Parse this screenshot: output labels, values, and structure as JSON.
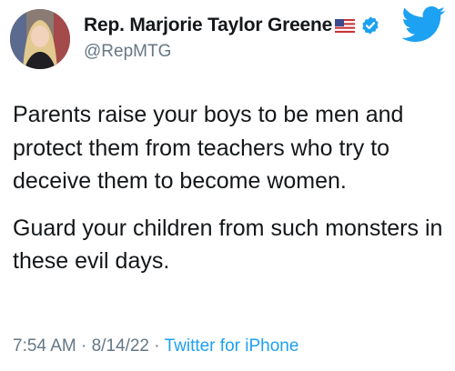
{
  "author": {
    "display_name": "Rep. Marjorie Taylor Greene",
    "handle": "@RepMTG",
    "flag_icon": "us-flag-icon",
    "verified_icon": "verified-badge-icon"
  },
  "app_icon": "twitter-bird-icon",
  "tweet": {
    "paragraphs": [
      "Parents raise your boys to be men and protect them from teachers who try to deceive them to become women.",
      "Guard your children from such monsters in these evil days."
    ]
  },
  "meta": {
    "time": "7:54 AM",
    "separator": " · ",
    "date": "8/14/22",
    "source": "Twitter for iPhone"
  },
  "colors": {
    "text": "#14171a",
    "secondary": "#657786",
    "accent": "#1da1f2"
  }
}
